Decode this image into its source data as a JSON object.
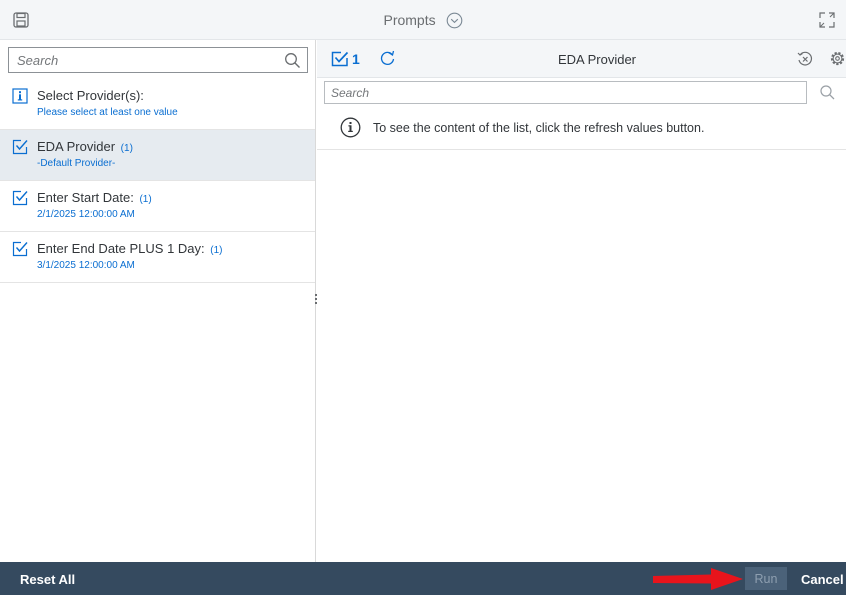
{
  "header": {
    "title": "Prompts",
    "icons": {
      "save": "save-icon",
      "dropdown": "chevron-down-circle-icon",
      "expand": "expand-icon"
    }
  },
  "left_panel": {
    "search_placeholder": "Search",
    "prompts": [
      {
        "name": "Select Provider(s):",
        "count": "",
        "value": "Please select at least one value",
        "icon": "info-icon",
        "selected": false
      },
      {
        "name": "EDA Provider",
        "count": "(1)",
        "value": "-Default Provider-",
        "icon": "checkbox-icon",
        "selected": true
      },
      {
        "name": "Enter Start Date:",
        "count": "(1)",
        "value": "2/1/2025 12:00:00 AM",
        "icon": "checkbox-icon",
        "selected": false
      },
      {
        "name": "Enter End Date PLUS 1 Day:",
        "count": "(1)",
        "value": "3/1/2025 12:00:00 AM",
        "icon": "checkbox-icon",
        "selected": false
      }
    ]
  },
  "right_panel": {
    "selected_count": "1",
    "title": "EDA Provider",
    "search_placeholder": "Search",
    "info_message": "To see the content of the list, click the refresh values button."
  },
  "footer": {
    "reset_label": "Reset All",
    "run_label": "Run",
    "cancel_label": "Cancel"
  },
  "colors": {
    "accent": "#0a6ed1",
    "footer_bg": "#354a5f",
    "arrow": "#e8141c"
  }
}
